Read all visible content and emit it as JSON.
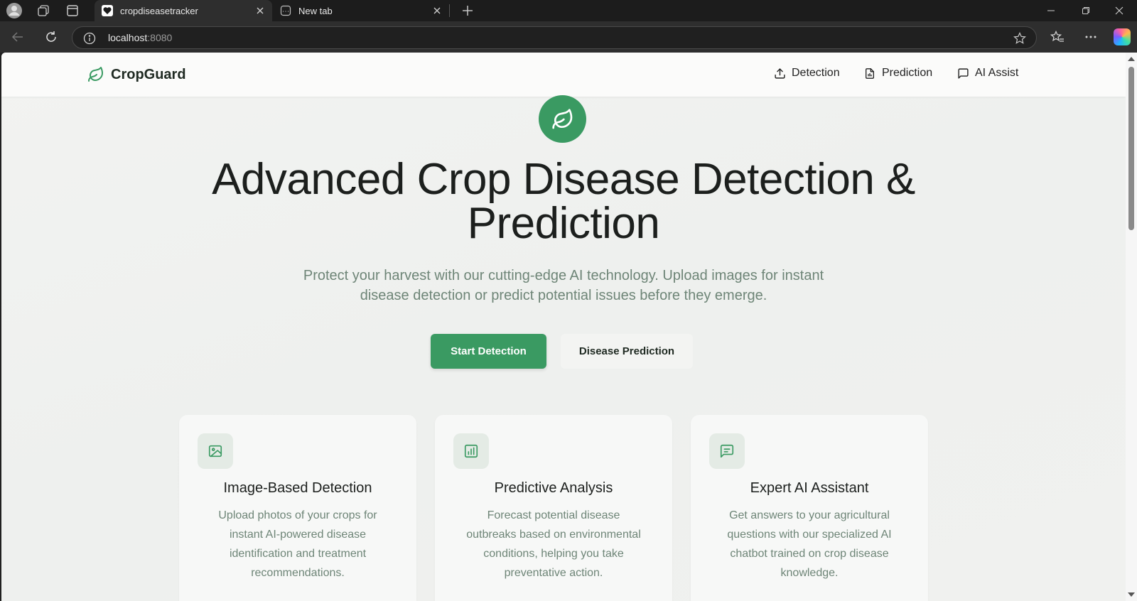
{
  "browser": {
    "tabs": [
      {
        "title": "cropdiseasetracker",
        "active": true
      },
      {
        "title": "New tab",
        "active": false
      }
    ],
    "address": {
      "host": "localhost",
      "port": ":8080"
    },
    "icons": [
      "profile-icon",
      "workspaces-icon",
      "tab-actions-icon",
      "back-icon",
      "refresh-icon",
      "info-icon",
      "favorite-star-icon",
      "favorites-icon",
      "more-icon",
      "copilot-icon"
    ]
  },
  "site": {
    "brand": "CropGuard",
    "nav": [
      {
        "label": "Detection",
        "icon": "upload-icon"
      },
      {
        "label": "Prediction",
        "icon": "document-chart-icon"
      },
      {
        "label": "AI Assist",
        "icon": "chat-icon"
      }
    ]
  },
  "hero": {
    "title": "Advanced Crop Disease Detection & Prediction",
    "subtitle": "Protect your harvest with our cutting-edge AI technology. Upload images for instant disease detection or predict potential issues before they emerge.",
    "primary_button": "Start Detection",
    "secondary_button": "Disease Prediction"
  },
  "features": [
    {
      "title": "Image-Based Detection",
      "description": "Upload photos of your crops for instant AI-powered disease identification and treatment recommendations.",
      "icon": "image-icon"
    },
    {
      "title": "Predictive Analysis",
      "description": "Forecast potential disease outbreaks based on environmental conditions, helping you take preventative action.",
      "icon": "bar-chart-icon"
    },
    {
      "title": "Expert AI Assistant",
      "description": "Get answers to your agricultural questions with our specialized AI chatbot trained on crop disease knowledge.",
      "icon": "message-icon"
    }
  ],
  "colors": {
    "accent": "#3a9a62",
    "muted_text": "#6e8577",
    "heading": "#1c1f1d"
  }
}
